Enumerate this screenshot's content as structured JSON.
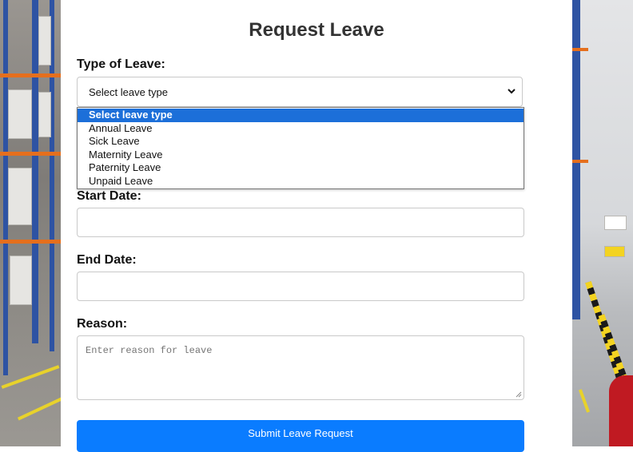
{
  "form": {
    "title": "Request Leave",
    "type_label": "Type of Leave:",
    "type_selected": "Select leave type",
    "type_options": [
      "Select leave type",
      "Annual Leave",
      "Sick Leave",
      "Maternity Leave",
      "Paternity Leave",
      "Unpaid Leave"
    ],
    "start_label": "Start Date:",
    "start_value": "",
    "end_label": "End Date:",
    "end_value": "",
    "reason_label": "Reason:",
    "reason_placeholder": "Enter reason for leave",
    "submit_label": "Submit Leave Request"
  },
  "icons": {
    "select_arrow": "chevron-down-icon",
    "textarea_grip": "resize-grip-icon"
  },
  "colors": {
    "accent": "#0a7cff",
    "highlight": "#1c6fd9",
    "title": "#333333"
  }
}
